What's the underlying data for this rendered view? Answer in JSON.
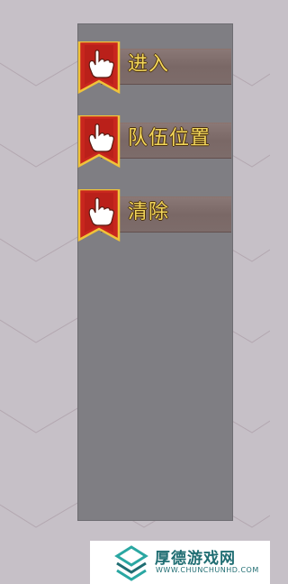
{
  "menu": {
    "items": [
      {
        "label": "进入",
        "icon": "hand-pointer-icon"
      },
      {
        "label": "队伍位置",
        "icon": "hand-pointer-icon"
      },
      {
        "label": "清除",
        "icon": "hand-pointer-icon"
      }
    ]
  },
  "colors": {
    "background": "#c6c0c7",
    "panel": "#7f7e83",
    "label_gold": "#f2d65a",
    "badge_red": "#c8261e",
    "watermark_teal": "#1f6d72"
  },
  "watermark": {
    "title": "厚德游戏网",
    "subtitle": "WWW.CHUNCHUNHD.COM"
  }
}
